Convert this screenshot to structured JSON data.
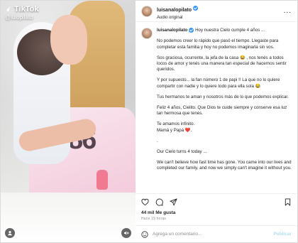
{
  "media": {
    "tiktok_brand": "TikTok",
    "tiktok_handle": "@lulopilato",
    "shirt_print": "86"
  },
  "header": {
    "username": "luisanalopilato",
    "subtitle": "Audio original",
    "more": "..."
  },
  "caption": {
    "username": "luisanalopilato",
    "paragraphs": [
      "Hoy nuestra Cielo cumple 4 años ...",
      "No podemos creer lo rápido que pasó el tiempo. Llegaste para completar esta familia y hoy no podemos imaginarla sin vos.",
      "Sos graciosa, ocurrente, la jefa de la casa 😂 , nos tenés a todos locos de amor y tenés una manera tan especial de hacernos sentir queridos.",
      "Y por supuesto... la fan número 1 de papi !! La que no lo quiere compartir con nadie y lo quiere todo para ella sola 😂",
      "Tus hermanos te aman y nosotros más de lo que podemos explicar.",
      "Feliz 4 años, Cielito. Que Dios te cuide siempre y conserve esa luz tan hermosa que tenés.",
      "Te amamos infinito.\nMamá y Papá ❤️.",
      ".",
      "Our Cielo turns 4 today ...",
      "We can't believe how fast time has gone. You came into our lives and completed our family, and now we simply can't imagine it without you."
    ]
  },
  "likes": "44 mil Me gusta",
  "time": "Hace 19 horas",
  "comment": {
    "placeholder": "Agrega un comentario...",
    "post_label": "Publicar"
  },
  "colors": {
    "verified": "#3897f0",
    "post": "#b2dffc",
    "muted": "#8e8e8e"
  }
}
